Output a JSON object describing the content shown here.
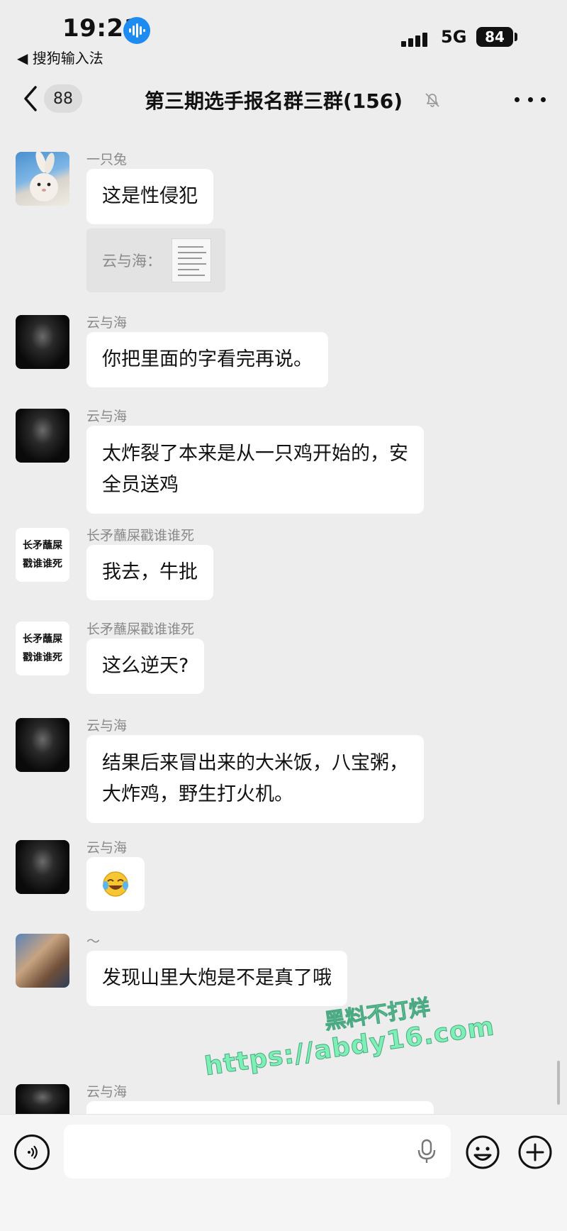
{
  "status_bar": {
    "time": "19:21",
    "back_app": "◀ 搜狗输入法",
    "network": "5G",
    "battery": "84"
  },
  "nav": {
    "unread_count": "88",
    "title": "第三期选手报名群三群(156)"
  },
  "messages": [
    {
      "sender": "一只兔",
      "avatar": "rabbit",
      "text": "这是性侵犯"
    },
    {
      "type": "quote",
      "quote_label": "云与海："
    },
    {
      "sender": "云与海",
      "avatar": "dark",
      "text": "你把里面的字看完再说。"
    },
    {
      "sender": "云与海",
      "avatar": "dark",
      "lines": [
        "太炸裂了本来是从一只鸡开始的，安",
        "全员送鸡"
      ]
    },
    {
      "sender": "长矛蘸屎戳谁谁死",
      "avatar": "text",
      "avatar_lines": [
        "长矛蘸屎",
        "戳谁谁死"
      ],
      "text": "我去，牛批"
    },
    {
      "sender": "长矛蘸屎戳谁谁死",
      "avatar": "text",
      "avatar_lines": [
        "长矛蘸屎",
        "戳谁谁死"
      ],
      "text": "这么逆天?"
    },
    {
      "sender": "云与海",
      "avatar": "dark",
      "lines": [
        "结果后来冒出来的大米饭，八宝粥，",
        "大炸鸡，野生打火机。"
      ]
    },
    {
      "sender": "云与海",
      "avatar": "dark",
      "emoji": "laughing-crying-emoji"
    },
    {
      "sender": "～",
      "avatar": "photo",
      "text": "发现山里大炮是不是真了哦"
    },
    {
      "sender": "云与海",
      "avatar": "dark",
      "text": ""
    }
  ],
  "watermark": {
    "line1": "黑料不打烊",
    "line2": "https://abdy16.com"
  },
  "input_bar": {
    "placeholder": ""
  },
  "icons": {
    "voice_badge": "voice-wave-icon",
    "signal": "signal-bars-icon",
    "back": "chevron-left-icon",
    "mute": "bell-muted-icon",
    "more": "more-dots-icon",
    "voice_input": "voice-input-icon",
    "mic": "microphone-icon",
    "emoji": "smiley-icon",
    "plus": "plus-circle-icon"
  },
  "colors": {
    "background": "#ededed",
    "bubble": "#ffffff",
    "voice_badge": "#1c8bf2",
    "watermark": "#7ef0b6"
  }
}
